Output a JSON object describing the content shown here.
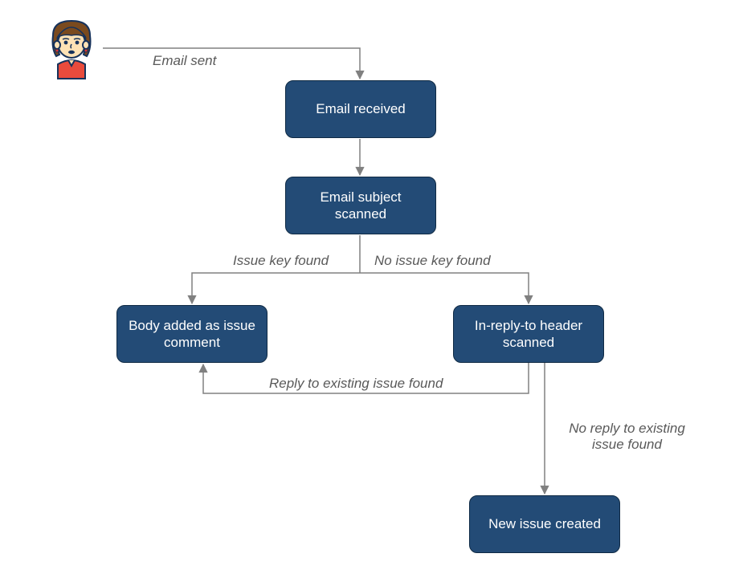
{
  "actor": {
    "name": "user-avatar"
  },
  "nodes": {
    "received": {
      "label": "Email received"
    },
    "scanned": {
      "label": "Email subject scanned"
    },
    "comment": {
      "label": "Body added as issue comment"
    },
    "inreply": {
      "label": "In-reply-to header scanned"
    },
    "newissue": {
      "label": "New issue created"
    }
  },
  "edges": {
    "sent": {
      "label": "Email sent"
    },
    "keyfound": {
      "label": "Issue key found"
    },
    "nokeyfound": {
      "label": "No issue key found"
    },
    "replyfound": {
      "label": "Reply to existing issue found"
    },
    "noreply": {
      "label": "No reply to existing issue found"
    }
  },
  "style": {
    "nodeFill": "#234b76",
    "nodeStroke": "#0f2a44",
    "lineColor": "#808080",
    "labelColor": "#595959"
  }
}
